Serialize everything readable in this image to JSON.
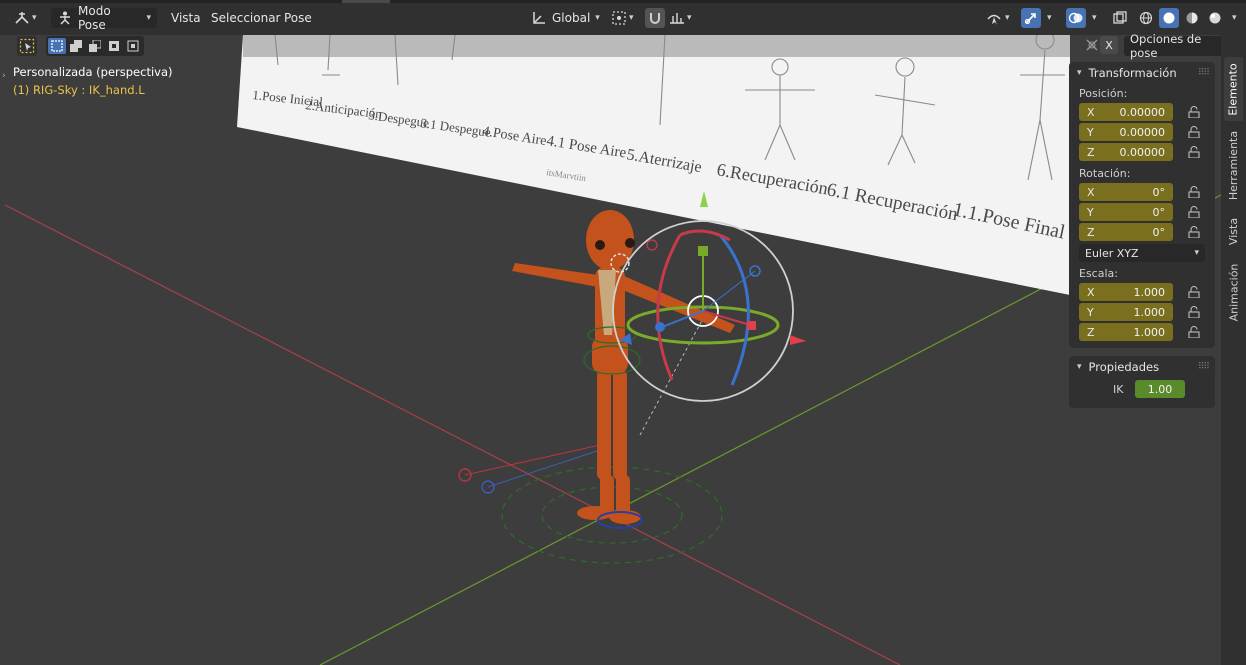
{
  "header": {
    "mode_label": "Modo Pose",
    "menus": [
      "Vista",
      "Seleccionar",
      "Pose"
    ],
    "transform_orientation": "Global",
    "pose_options_label": "Opciones de pose",
    "close_label": "X"
  },
  "viewport": {
    "view_name": "Personalizada (perspectiva)",
    "active_object": "(1) RIG-Sky : IK_hand.L",
    "reference_labels": [
      "1.Pose Inicial",
      "2.Anticipación",
      "3.Despegue",
      "3.1 Despegue",
      "4.Pose Aire",
      "4.1 Pose Aire",
      "5.Aterrizaje",
      "6.Recuperación",
      "6.1 Recuperación",
      "1.1.Pose Final"
    ],
    "reference_credit": "itsMarvtiin"
  },
  "sidebar": {
    "transform": {
      "title": "Transformación",
      "position_label": "Posición:",
      "position": [
        {
          "axis": "X",
          "value": "0.00000"
        },
        {
          "axis": "Y",
          "value": "0.00000"
        },
        {
          "axis": "Z",
          "value": "0.00000"
        }
      ],
      "rotation_label": "Rotación:",
      "rotation": [
        {
          "axis": "X",
          "value": "0°"
        },
        {
          "axis": "Y",
          "value": "0°"
        },
        {
          "axis": "Z",
          "value": "0°"
        }
      ],
      "rotation_mode": "Euler XYZ",
      "scale_label": "Escala:",
      "scale": [
        {
          "axis": "X",
          "value": "1.000"
        },
        {
          "axis": "Y",
          "value": "1.000"
        },
        {
          "axis": "Z",
          "value": "1.000"
        }
      ]
    },
    "properties": {
      "title": "Propiedades",
      "ik_label": "IK",
      "ik_value": "1.00"
    },
    "tabs": [
      "Elemento",
      "Herramienta",
      "Vista",
      "Animación"
    ]
  },
  "colors": {
    "field_yellow": "#7a6f1e",
    "ik_green": "#5a8a2a",
    "accent_blue": "#4772b3",
    "active_bone_text": "#e8c34a",
    "x_axis": "#b5363f",
    "y_axis": "#6a9a2a"
  },
  "icons": {
    "editor_type": "armature-editor-icon",
    "pose_mode": "pose-mode-icon",
    "orientation": "orientation-axes-icon",
    "pivot": "pivot-point-icon",
    "snap": "snap-magnet-icon",
    "proportional": "proportional-edit-icon",
    "gizmo": "gizmo-icon",
    "overlays": "overlays-icon",
    "xray": "xray-icon",
    "shading": [
      "wireframe-icon",
      "solid-icon",
      "material-preview-icon",
      "rendered-icon"
    ],
    "lock": "padlock-icon"
  }
}
